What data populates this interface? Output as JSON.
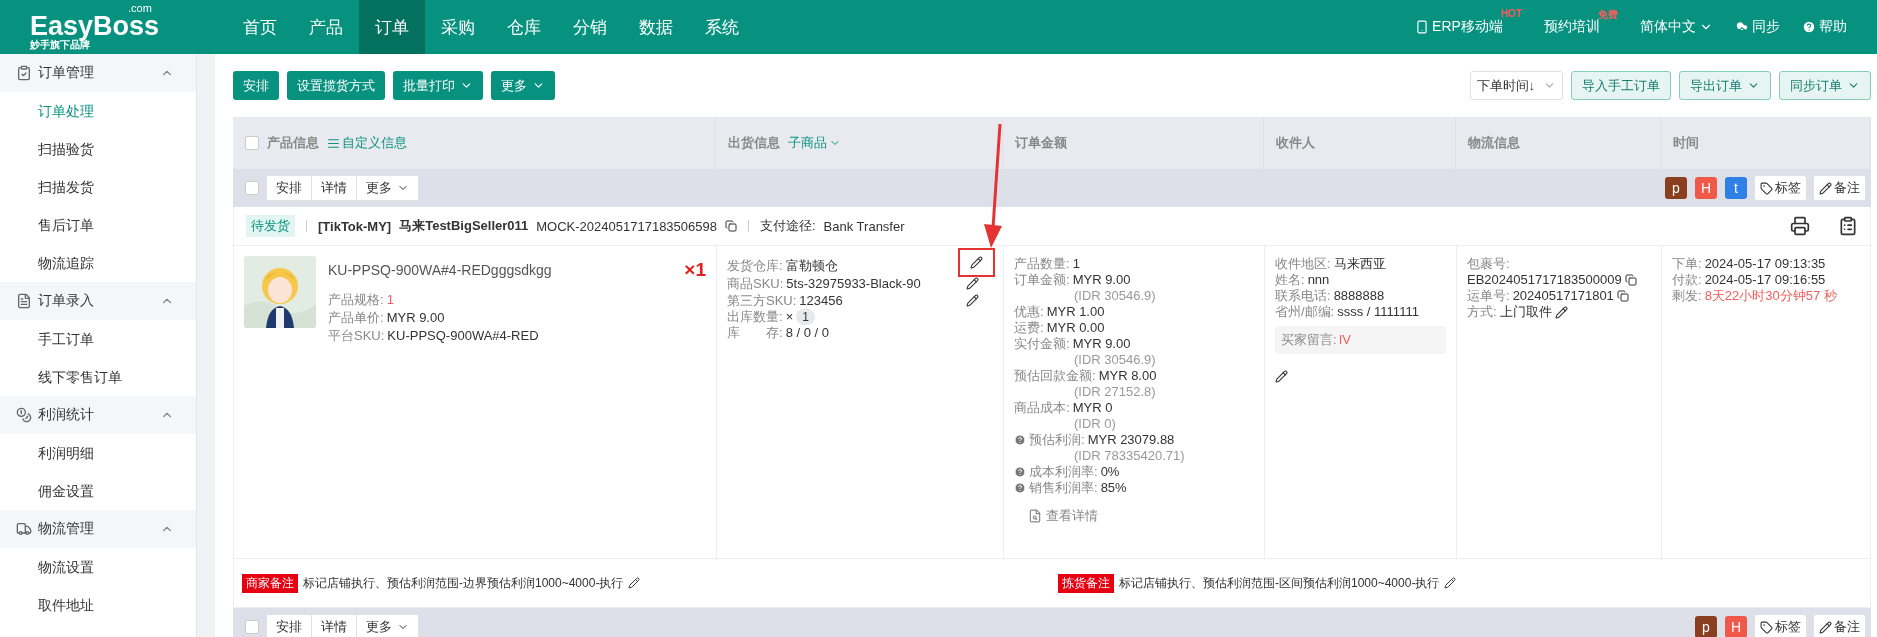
{
  "brand": {
    "name": "EasyBoss",
    "domain": ".com",
    "tagline": "妙手旗下品牌"
  },
  "nav": [
    {
      "label": "首页",
      "selected": false
    },
    {
      "label": "产品",
      "selected": false
    },
    {
      "label": "订单",
      "selected": true
    },
    {
      "label": "采购",
      "selected": false
    },
    {
      "label": "仓库",
      "selected": false
    },
    {
      "label": "分销",
      "selected": false
    },
    {
      "label": "数据",
      "selected": false
    },
    {
      "label": "系统",
      "selected": false
    }
  ],
  "top_links": [
    {
      "kind": "mobile",
      "label": "ERP移动端",
      "badge": "HOT"
    },
    {
      "kind": "plain",
      "label": "预约培训",
      "badge": "免费"
    },
    {
      "kind": "language",
      "label": "简体中文"
    },
    {
      "kind": "sync",
      "label": "同步"
    },
    {
      "kind": "help",
      "label": "帮助"
    }
  ],
  "sidebar": [
    {
      "label": "订单管理",
      "expanded": true,
      "children": [
        {
          "label": "订单处理",
          "selected": true
        },
        {
          "label": "扫描验货",
          "selected": false
        },
        {
          "label": "扫描发货",
          "selected": false
        },
        {
          "label": "售后订单",
          "selected": false
        },
        {
          "label": "物流追踪",
          "selected": false
        }
      ]
    },
    {
      "label": "订单录入",
      "expanded": true,
      "children": [
        {
          "label": "手工订单",
          "selected": false
        },
        {
          "label": "线下零售订单",
          "selected": false
        }
      ]
    },
    {
      "label": "利润统计",
      "expanded": true,
      "children": [
        {
          "label": "利润明细",
          "selected": false
        },
        {
          "label": "佣金设置",
          "selected": false
        }
      ]
    },
    {
      "label": "物流管理",
      "expanded": true,
      "children": [
        {
          "label": "物流设置",
          "selected": false
        },
        {
          "label": "取件地址",
          "selected": false
        }
      ]
    }
  ],
  "toolbar": {
    "left_buttons": [
      {
        "label": "安排",
        "dropdown": false
      },
      {
        "label": "设置揽货方式",
        "dropdown": false
      },
      {
        "label": "批量打印",
        "dropdown": true
      },
      {
        "label": "更多",
        "dropdown": true
      }
    ],
    "sort_select": {
      "value": "下单时间↓"
    },
    "right_buttons": [
      {
        "label": "导入手工订单",
        "dropdown": false
      },
      {
        "label": "导出订单",
        "dropdown": true
      },
      {
        "label": "同步订单",
        "dropdown": true
      }
    ]
  },
  "table": {
    "select_all": {
      "checked": false
    },
    "columns": [
      {
        "label": "产品信息",
        "link": "自定义信息"
      },
      {
        "label": "出货信息",
        "link": "子商品"
      },
      {
        "label": "订单金额"
      },
      {
        "label": "收件人"
      },
      {
        "label": "物流信息"
      },
      {
        "label": "时间"
      }
    ],
    "orders": [
      {
        "checked": false,
        "actions": [
          {
            "label": "安排",
            "dropdown": false
          },
          {
            "label": "详情",
            "dropdown": false
          },
          {
            "label": "更多",
            "dropdown": true
          }
        ],
        "tags": [
          {
            "label": "p",
            "color": "#8a3f1f"
          },
          {
            "label": "H",
            "color": "#f0584a"
          },
          {
            "label": "t",
            "color": "#2f80e6"
          }
        ],
        "tag_button": "标签",
        "note_button": "备注",
        "info": {
          "status": "待发货",
          "platform": "[TikTok-MY]",
          "shop": "马来TestBigSeller011",
          "order_no": "MOCK-2024051717183506598",
          "payment_label": "支付途径:",
          "payment": "Bank Transfer"
        },
        "product": {
          "kind": "picture",
          "title": "KU-PPSQ-900WA#4-REDgggsdkgg",
          "quantity": "×1",
          "fields": [
            {
              "label": "产品规格:",
              "value": "1",
              "alert": true
            },
            {
              "label": "产品单价:",
              "value": "MYR 9.00",
              "alert": false
            },
            {
              "label": "平台SKU:",
              "value": "KU-PPSQ-900WA#4-RED",
              "alert": false
            }
          ]
        },
        "shipping": [
          {
            "kind": "editable",
            "label": "发货仓库:",
            "value": "富勒顿仓",
            "highlighted": true
          },
          {
            "kind": "editable",
            "label": "商品SKU:",
            "value": "5ts-32975933-Black-90",
            "highlighted": false
          },
          {
            "kind": "editable",
            "label": "第三方SKU:",
            "value": "123456",
            "highlighted": false
          },
          {
            "kind": "count",
            "label": "出库数量:",
            "value": "×",
            "count": "1"
          },
          {
            "kind": "plain",
            "label": "库　　存:",
            "value": "8 / 0 / 0"
          }
        ],
        "amounts": [
          {
            "kind": "plain",
            "label": "产品数量:",
            "value": "1"
          },
          {
            "kind": "plain",
            "label": "订单金额:",
            "value": "MYR 9.00",
            "sub": "(IDR 30546.9)"
          },
          {
            "kind": "plain",
            "label": "优惠:",
            "value": "MYR 1.00"
          },
          {
            "kind": "plain",
            "label": "运费:",
            "value": "MYR 0.00"
          },
          {
            "kind": "plain",
            "label": "实付金额:",
            "value": "MYR 9.00",
            "sub": "(IDR 30546.9)"
          },
          {
            "kind": "plain",
            "label": "预估回款金额:",
            "value": "MYR 8.00",
            "sub": "(IDR 27152.8)"
          },
          {
            "kind": "plain",
            "label": "商品成本:",
            "value": "MYR 0",
            "sub": "(IDR 0)"
          },
          {
            "kind": "help",
            "label": "预估利润:",
            "value": "MYR 23079.88",
            "sub": "(IDR 78335420.71)"
          },
          {
            "kind": "help",
            "label": "成本利润率:",
            "value": "0%"
          },
          {
            "kind": "help",
            "label": "销售利润率:",
            "value": "85%"
          }
        ],
        "view_details": "查看详情",
        "receiver": {
          "fields": [
            {
              "label": "收件地区:",
              "value": "马来西亚"
            },
            {
              "label": "姓名:",
              "value": "nnn"
            },
            {
              "label": "联系电话:",
              "value": "8888888"
            },
            {
              "label": "省州/邮编:",
              "value": "ssss / 1111111"
            }
          ],
          "message_label": "买家留言:",
          "message": "IV"
        },
        "logistics": [
          {
            "kind": "label",
            "label": "包裹号:"
          },
          {
            "kind": "copy",
            "value": "EB2024051717183500009"
          },
          {
            "kind": "copy",
            "label": "运单号:",
            "value": "20240517171801"
          },
          {
            "kind": "edit",
            "label": "方式:",
            "value": "上门取件"
          }
        ],
        "times": [
          {
            "label": "下单:",
            "value": "2024-05-17 09:13:35",
            "alert": false
          },
          {
            "label": "付款:",
            "value": "2024-05-17 09:16:55",
            "alert": false
          },
          {
            "label": "剩发:",
            "value": "8天22小时30分钟57 秒",
            "alert": true
          }
        ],
        "notes": [
          {
            "label": "商家备注",
            "text": "标记店铺执行、预估利润范围-边界预估利润1000~4000-执行"
          },
          {
            "label": "拣货备注",
            "text": "标记店铺执行、预估利润范围-区间预估利润1000~4000-执行"
          }
        ]
      },
      {
        "checked": false,
        "actions": [
          {
            "label": "安排",
            "dropdown": false
          },
          {
            "label": "详情",
            "dropdown": false
          },
          {
            "label": "更多",
            "dropdown": true
          }
        ],
        "tags": [
          {
            "label": "p",
            "color": "#8a3f1f"
          },
          {
            "label": "H",
            "color": "#f0584a"
          }
        ],
        "tag_button": "标签",
        "note_button": "备注"
      }
    ]
  }
}
